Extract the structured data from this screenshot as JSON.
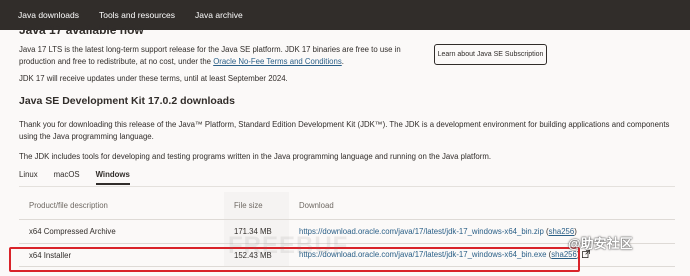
{
  "nav": {
    "items": [
      "Java downloads",
      "Tools and resources",
      "Java archive"
    ]
  },
  "header": {
    "partial_title": "Java 17 available now"
  },
  "intro": {
    "text_before_link": "Java 17 LTS is the latest long-term support release for the Java SE platform. JDK 17 binaries are free to use in production and free to redistribute, at no cost, under the ",
    "link_text": "Oracle No-Fee Terms and Conditions",
    "text_after_link": ".",
    "updates_text": "JDK 17 will receive updates under these terms, until at least September 2024.",
    "subscription_button": "Learn about Java SE Subscription"
  },
  "downloads": {
    "heading": "Java SE Development Kit 17.0.2 downloads",
    "thank_you_text": "Thank you for downloading this release of the Java™ Platform, Standard Edition Development Kit (JDK™). The JDK is a development environment for building applications and components using the Java programming language.",
    "tools_text": "The JDK includes tools for developing and testing programs written in the Java programming language and running on the Java platform.",
    "os_tabs": [
      "Linux",
      "macOS",
      "Windows"
    ],
    "active_tab": "Windows",
    "table": {
      "headers": [
        "Product/file description",
        "File size",
        "Download"
      ],
      "rows": [
        {
          "product": "x64 Compressed Archive",
          "size": "171.34 MB",
          "link": "https://download.oracle.com/java/17/latest/jdk-17_windows-x64_bin.zip",
          "checksum_prefix": " (",
          "checksum": "sha256",
          "checksum_suffix": ")"
        },
        {
          "product": "x64 Installer",
          "size": "152.43 MB",
          "link": "https://download.oracle.com/java/17/latest/jdk-17_windows-x64_bin.exe",
          "checksum_prefix": " (",
          "checksum": "sha256",
          "checksum_suffix": ")"
        }
      ]
    }
  },
  "watermarks": {
    "freebuf": "FREEBUF",
    "community": "@助安社区"
  },
  "colors": {
    "nav_background": "#312d2a",
    "link": "#2a5f87",
    "highlight_border": "#d9232a",
    "page_background": "#fbf9f8"
  }
}
